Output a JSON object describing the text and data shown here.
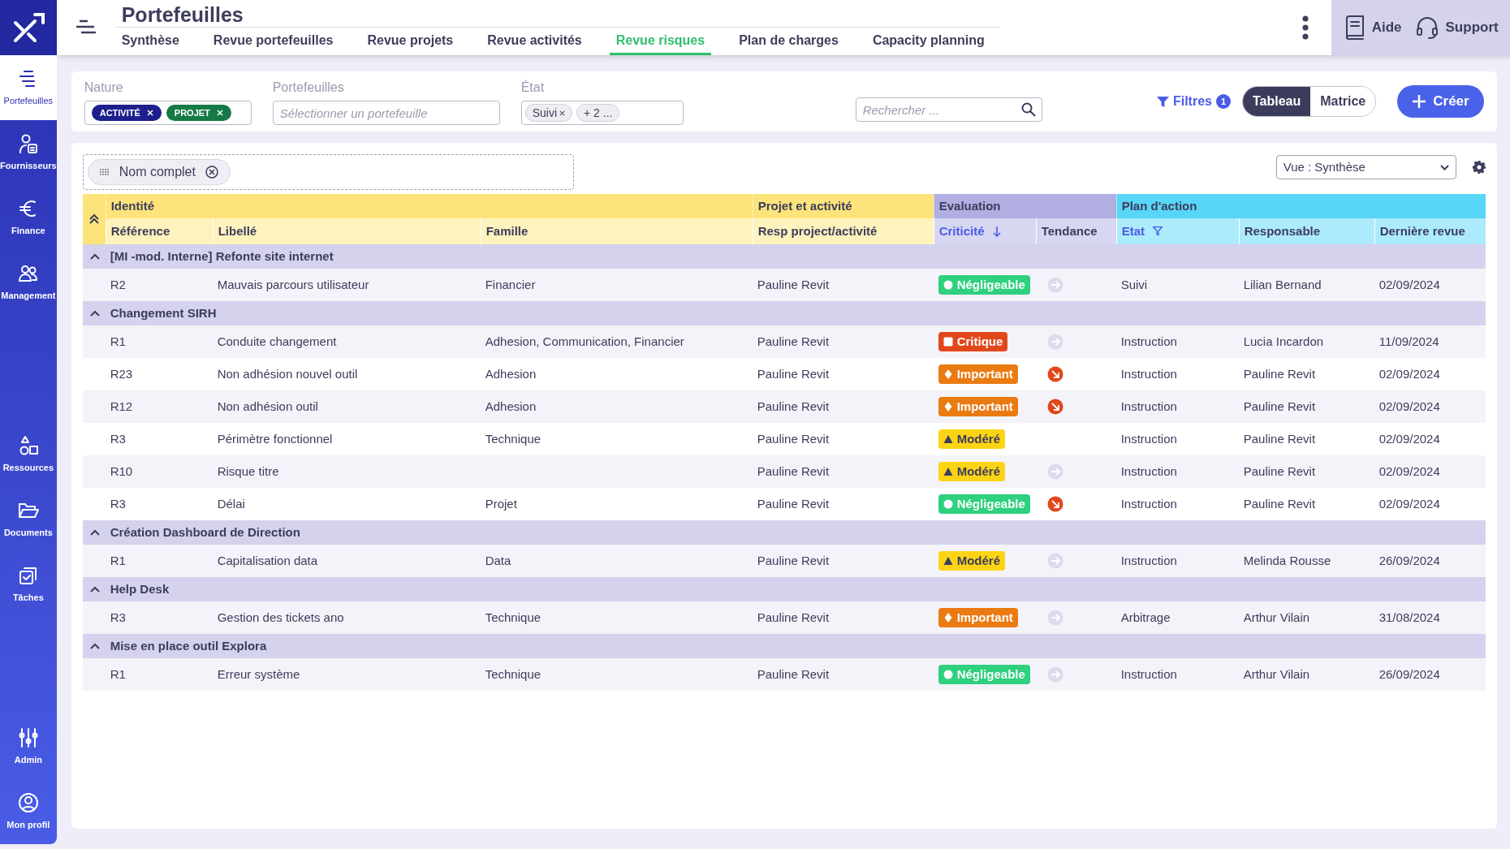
{
  "sidebar": {
    "items": [
      {
        "label": "Portefeuilles",
        "kind": "portfolio",
        "selected": true
      },
      {
        "label": "Fournisseurs",
        "kind": "supplier",
        "selected": false
      },
      {
        "label": "Finance",
        "kind": "euro",
        "selected": false
      },
      {
        "label": "Management",
        "kind": "people",
        "selected": false
      },
      {
        "label": "Ressources",
        "kind": "shapes",
        "selected": false
      },
      {
        "label": "Documents",
        "kind": "folder",
        "selected": false
      },
      {
        "label": "Tâches",
        "kind": "tasks",
        "selected": false
      },
      {
        "label": "Admin",
        "kind": "sliders",
        "selected": false
      },
      {
        "label": "Mon profil",
        "kind": "profile",
        "selected": false
      }
    ]
  },
  "header": {
    "title": "Portefeuilles",
    "tabs": [
      {
        "label": "Synthèse",
        "selected": false
      },
      {
        "label": "Revue portefeuilles",
        "selected": false
      },
      {
        "label": "Revue projets",
        "selected": false
      },
      {
        "label": "Revue activités",
        "selected": false
      },
      {
        "label": "Revue risques",
        "selected": true
      },
      {
        "label": "Plan de charges",
        "selected": false
      },
      {
        "label": "Capacity planning",
        "selected": false
      }
    ],
    "help": "Aide",
    "support": "Support"
  },
  "filters": {
    "nature": {
      "label": "Nature",
      "chips": [
        {
          "label": "ACTIVITÉ",
          "color": "#1c1f8c"
        },
        {
          "label": "PROJET",
          "color": "#157a46"
        }
      ]
    },
    "portefeuilles": {
      "label": "Portefeuilles",
      "placeholder": "Sélectionner un portefeuille"
    },
    "etat": {
      "label": "État",
      "chips": [
        "Suivi",
        "+ 2 ..."
      ]
    },
    "search": {
      "placeholder": "Rechercher ..."
    },
    "filters_button": {
      "label": "Filtres",
      "count": "1"
    },
    "views": [
      {
        "label": "Tableau",
        "selected": true
      },
      {
        "label": "Matrice",
        "selected": false
      }
    ],
    "create": "Créer"
  },
  "grouping": {
    "chips": [
      "Nom complet"
    ]
  },
  "view_select": "Vue : Synthèse",
  "table": {
    "column_groups": [
      {
        "label": "Identité",
        "color": "#fde47a",
        "columns": [
          {
            "label": "Référence",
            "sorted": false,
            "filtered": false
          },
          {
            "label": "Libellé",
            "sorted": false,
            "filtered": false
          },
          {
            "label": "Famille",
            "sorted": false,
            "filtered": false
          }
        ]
      },
      {
        "label": "Projet et activité",
        "color": "#fde47a",
        "columns": [
          {
            "label": "Resp project/activité",
            "sorted": false,
            "filtered": false
          }
        ]
      },
      {
        "label": "Evaluation",
        "color": "#b1aee2",
        "columns": [
          {
            "label": "Criticité",
            "sorted": true,
            "filtered": false
          },
          {
            "label": "Tendance",
            "sorted": false,
            "filtered": false
          }
        ]
      },
      {
        "label": "Plan d'action",
        "color": "#58d6f7",
        "columns": [
          {
            "label": "Etat",
            "sorted": false,
            "filtered": true
          },
          {
            "label": "Responsable",
            "sorted": false,
            "filtered": false
          },
          {
            "label": "Dernière revue",
            "sorted": false,
            "filtered": false
          }
        ]
      }
    ],
    "groups": [
      {
        "title": "[MI -mod. Interne] Refonte site internet",
        "expanded": true,
        "rows": [
          {
            "cells": [
              "R2",
              "Mauvais parcours utilisateur",
              "Financier",
              "Pauline Revit"
            ],
            "criticite": {
              "kind": "negligeable",
              "label": "Négligeable"
            },
            "tendance": {
              "kind": "flat"
            },
            "plan": [
              "Suivi",
              "Lilian Bernand",
              "02/09/2024"
            ]
          }
        ]
      },
      {
        "title": "Changement SIRH",
        "expanded": true,
        "rows": [
          {
            "cells": [
              "R1",
              "Conduite changement",
              "Adhesion, Communication, Financier",
              "Pauline Revit"
            ],
            "criticite": {
              "kind": "critique",
              "label": "Critique"
            },
            "tendance": {
              "kind": "flat"
            },
            "plan": [
              "Instruction",
              "Lucia Incardon",
              "11/09/2024"
            ]
          },
          {
            "cells": [
              "R23",
              "Non adhésion nouvel outil",
              "Adhesion",
              "Pauline Revit"
            ],
            "criticite": {
              "kind": "important",
              "label": "Important"
            },
            "tendance": {
              "kind": "down"
            },
            "plan": [
              "Instruction",
              "Pauline Revit",
              "02/09/2024"
            ]
          },
          {
            "cells": [
              "R12",
              "Non adhésion outil",
              "Adhesion",
              "Pauline Revit"
            ],
            "criticite": {
              "kind": "important",
              "label": "Important"
            },
            "tendance": {
              "kind": "down"
            },
            "plan": [
              "Instruction",
              "Pauline Revit",
              "02/09/2024"
            ]
          },
          {
            "cells": [
              "R3",
              "Périmètre fonctionnel",
              "Technique",
              "Pauline Revit"
            ],
            "criticite": {
              "kind": "modere",
              "label": "Modéré"
            },
            "plan": [
              "Instruction",
              "Pauline Revit",
              "02/09/2024"
            ]
          },
          {
            "cells": [
              "R10",
              "Risque titre",
              "",
              "Pauline Revit"
            ],
            "criticite": {
              "kind": "modere",
              "label": "Modéré"
            },
            "tendance": {
              "kind": "flat"
            },
            "plan": [
              "Instruction",
              "Pauline Revit",
              "02/09/2024"
            ]
          },
          {
            "cells": [
              "R3",
              "Délai",
              "Projet",
              "Pauline Revit"
            ],
            "criticite": {
              "kind": "negligeable",
              "label": "Négligeable"
            },
            "tendance": {
              "kind": "down"
            },
            "plan": [
              "Instruction",
              "Pauline Revit",
              "02/09/2024"
            ]
          }
        ]
      },
      {
        "title": "Création Dashboard de Direction",
        "expanded": true,
        "rows": [
          {
            "cells": [
              "R1",
              "Capitalisation data",
              "Data",
              "Pauline Revit"
            ],
            "criticite": {
              "kind": "modere",
              "label": "Modéré"
            },
            "tendance": {
              "kind": "flat"
            },
            "plan": [
              "Instruction",
              "Melinda Rousse",
              "26/09/2024"
            ]
          }
        ]
      },
      {
        "title": "Help Desk",
        "expanded": true,
        "rows": [
          {
            "cells": [
              "R3",
              "Gestion des tickets ano",
              "Technique",
              "Pauline Revit"
            ],
            "criticite": {
              "kind": "important",
              "label": "Important"
            },
            "tendance": {
              "kind": "flat"
            },
            "plan": [
              "Arbitrage",
              "Arthur Vilain",
              "31/08/2024"
            ]
          }
        ]
      },
      {
        "title": "Mise en place outil Explora",
        "expanded": true,
        "rows": [
          {
            "cells": [
              "R1",
              "Erreur système",
              "Technique",
              "Pauline Revit"
            ],
            "criticite": {
              "kind": "negligeable",
              "label": "Négligeable"
            },
            "tendance": {
              "kind": "flat"
            },
            "plan": [
              "Instruction",
              "Arthur Vilain",
              "26/09/2024"
            ]
          }
        ]
      }
    ]
  }
}
